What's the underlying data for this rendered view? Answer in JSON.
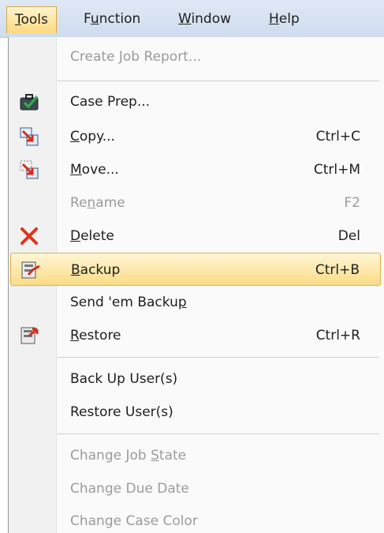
{
  "menubar": {
    "items": [
      {
        "pre": "",
        "key": "T",
        "post": "ools"
      },
      {
        "pre": "F",
        "key": "u",
        "post": "nction"
      },
      {
        "pre": "",
        "key": "W",
        "post": "indow"
      },
      {
        "pre": "",
        "key": "H",
        "post": "elp"
      }
    ]
  },
  "menu": {
    "items": [
      {
        "pre": "Create ",
        "key": "J",
        "post": "ob Report...",
        "shortcut": "",
        "disabled": true
      },
      {
        "pre": "Case Prep...",
        "key": "",
        "post": "",
        "shortcut": "",
        "icon": "case-prep-icon"
      },
      {
        "pre": "",
        "key": "C",
        "post": "opy...",
        "shortcut": "Ctrl+C",
        "icon": "copy-icon"
      },
      {
        "pre": "",
        "key": "M",
        "post": "ove...",
        "shortcut": "Ctrl+M",
        "icon": "move-icon"
      },
      {
        "pre": "Re",
        "key": "n",
        "post": "ame",
        "shortcut": "F2",
        "disabled": true
      },
      {
        "pre": "",
        "key": "D",
        "post": "elete",
        "shortcut": "Del",
        "icon": "delete-icon"
      },
      {
        "pre": "",
        "key": "B",
        "post": "ackup",
        "shortcut": "Ctrl+B",
        "icon": "backup-icon",
        "highlighted": true
      },
      {
        "pre": "Send 'em Backu",
        "key": "p",
        "post": "",
        "shortcut": ""
      },
      {
        "pre": "",
        "key": "R",
        "post": "estore",
        "shortcut": "Ctrl+R",
        "icon": "restore-icon"
      },
      {
        "pre": "Back Up User(s)",
        "key": "",
        "post": "",
        "shortcut": ""
      },
      {
        "pre": "Restore User(s)",
        "key": "",
        "post": "",
        "shortcut": ""
      },
      {
        "pre": "Change Job ",
        "key": "S",
        "post": "tate",
        "shortcut": "",
        "disabled": true
      },
      {
        "pre": "Chan",
        "key": "g",
        "post": "e Due Date",
        "shortcut": "",
        "disabled": true
      },
      {
        "pre": "Change Case Color",
        "key": "",
        "post": "",
        "shortcut": "",
        "disabled": true
      }
    ]
  },
  "colors": {
    "menubar": "#d6e2f1",
    "highlight": "#fbdc85",
    "disabled_text": "#9b9b9b",
    "delete_red": "#e0341c"
  }
}
